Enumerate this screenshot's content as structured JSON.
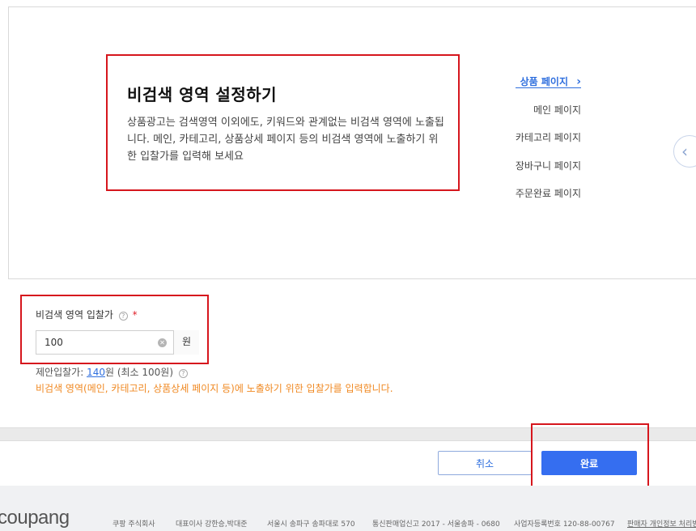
{
  "intro": {
    "title": "비검색 영역 설정하기",
    "description": "상품광고는 검색영역 이외에도, 키워드와 관계없는 비검색 영역에 노출됩니다. 메인, 카테고리, 상품상세 페이지 등의 비검색 영역에 노출하기 위한 입찰가를 입력해 보세요"
  },
  "page_nav": {
    "items": [
      {
        "label": "상품 페이지",
        "active": true
      },
      {
        "label": "메인 페이지",
        "active": false
      },
      {
        "label": "카테고리 페이지",
        "active": false
      },
      {
        "label": "장바구니 페이지",
        "active": false
      },
      {
        "label": "주문완료 페이지",
        "active": false
      }
    ],
    "chevron": "›"
  },
  "carousel": {
    "prev_icon": "chevron-left-icon",
    "prev_glyph": "‹"
  },
  "bid": {
    "label": "비검색 영역 입찰가",
    "help_glyph": "?",
    "required_mark": "*",
    "value": "100",
    "clear_glyph": "✕",
    "unit": "원",
    "suggest_prefix": "제안입찰가: ",
    "suggest_value": "140",
    "suggest_suffix": "원 (최소 100원)",
    "warning": "비검색 영역(메인, 카테고리, 상품상세 페이지 등)에 노출하기 위한 입찰가를 입력합니다."
  },
  "actions": {
    "cancel": "취소",
    "done": "완료"
  },
  "footer": {
    "logo": "coupang",
    "items": [
      "쿠팡 주식회사",
      "대표이사 강한승,박대준",
      "서울시 송파구 송파대로 570",
      "통신판매업신고 2017 - 서울송파 - 0680",
      "사업자등록번호 120-88-00767",
      "판매자 개인정보 처리방"
    ]
  },
  "colors": {
    "accent": "#356ef0",
    "link": "#2f6fde",
    "highlight": "#d6161d",
    "warning": "#f08a24"
  }
}
